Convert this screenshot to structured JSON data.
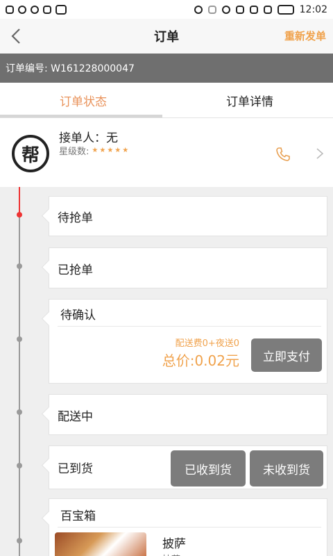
{
  "status_bar": {
    "time": "12:02"
  },
  "nav": {
    "title": "订单",
    "resubmit_label": "重新发单"
  },
  "order": {
    "number_text": "订单编号: W161228000047"
  },
  "tabs": [
    {
      "label": "订单状态",
      "active": true
    },
    {
      "label": "订单详情",
      "active": false
    }
  ],
  "courier": {
    "name_text": "接单人：无",
    "rating_label": "星级数:",
    "stars": "★★★★★",
    "avatar_char": "帮"
  },
  "timeline": {
    "waiting_grab": "待抢单",
    "grabbed": "已抢单",
    "to_confirm": {
      "label": "待确认",
      "fee_text": "配送费0+夜送0",
      "total_text": "总价:0.02元",
      "pay_button": "立即支付"
    },
    "delivering": "配送中",
    "arrived": {
      "label": "已到货",
      "received_button": "已收到货",
      "not_received_button": "未收到货"
    },
    "treasure_box": {
      "label": "百宝箱",
      "item_name": "披萨",
      "item_sub": "披萨"
    }
  },
  "colors": {
    "accent": "#f0a24c",
    "tab_active": "#e9925a",
    "order_bar": "#6f6f6f",
    "timeline_red": "#ee3333",
    "button_gray": "#7c7c7c"
  }
}
